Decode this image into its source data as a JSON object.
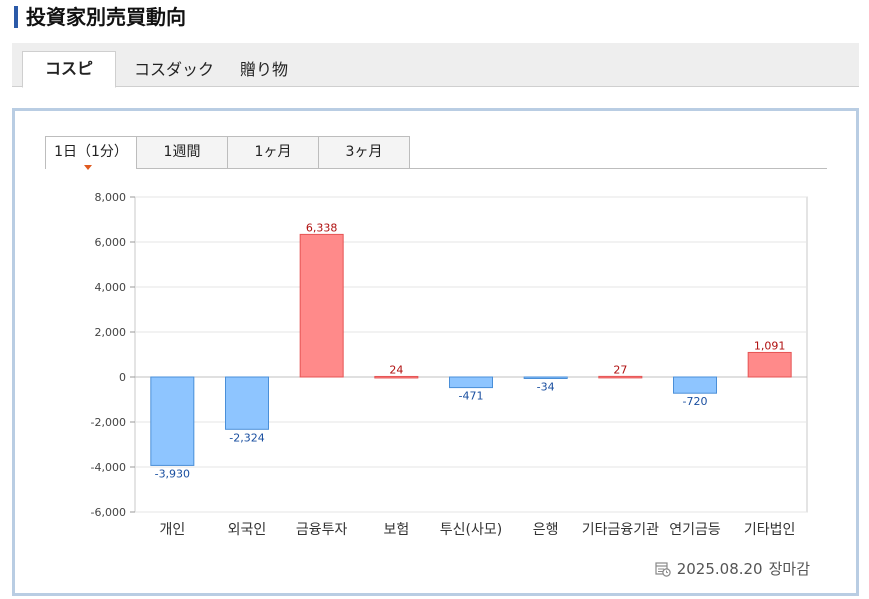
{
  "page": {
    "title": "投資家別売買動向"
  },
  "market_tabs": [
    {
      "label": "コスピ",
      "active": true
    },
    {
      "label": "コスダック",
      "active": false
    },
    {
      "label": "贈り物",
      "active": false
    }
  ],
  "period_tabs": [
    {
      "label": "1日（1分）",
      "active": true
    },
    {
      "label": "1週間",
      "active": false
    },
    {
      "label": "1ヶ月",
      "active": false
    },
    {
      "label": "3ヶ月",
      "active": false
    }
  ],
  "footer": {
    "date": "2025.08.20",
    "status": "장마감",
    "icon": "calendar-clock-icon"
  },
  "colors": {
    "positive_fill": "#ff8a8a",
    "positive_stroke": "#e55454",
    "negative_fill": "#8ec5ff",
    "negative_stroke": "#4a8fd8",
    "positive_label": "#b01010",
    "negative_label": "#1a4fa0",
    "accent": "#2b5aa8"
  },
  "chart_data": {
    "type": "bar",
    "categories": [
      "개인",
      "외국인",
      "금융투자",
      "보험",
      "투신(사모)",
      "은행",
      "기타금융기관",
      "연기금등",
      "기타법인"
    ],
    "values": [
      -3930,
      -2324,
      6338,
      24,
      -471,
      -34,
      27,
      -720,
      1091
    ],
    "value_labels": [
      "-3,930",
      "-2,324",
      "6,338",
      "24",
      "-471",
      "-34",
      "27",
      "-720",
      "1,091"
    ],
    "ylim": [
      -6000,
      8000
    ],
    "yticks": [
      8000,
      6000,
      4000,
      2000,
      0,
      -2000,
      -4000,
      -6000
    ],
    "ytick_labels": [
      "8,000",
      "6,000",
      "4,000",
      "2,000",
      "0",
      "-2,000",
      "-4,000",
      "-6,000"
    ],
    "grid": true,
    "title": "",
    "xlabel": "",
    "ylabel": ""
  }
}
